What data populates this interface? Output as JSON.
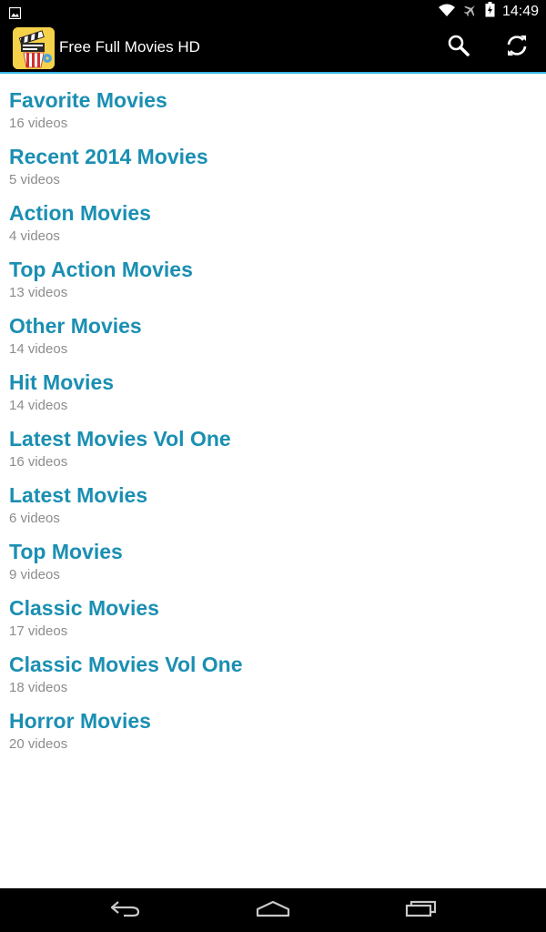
{
  "status_bar": {
    "time": "14:49",
    "icons": [
      "image-notification-icon",
      "wifi-icon",
      "airplane-mode-icon",
      "battery-icon"
    ]
  },
  "action_bar": {
    "app_title": "Free Full Movies HD",
    "actions": [
      "search-icon",
      "refresh-icon"
    ]
  },
  "colors": {
    "accent": "#33b5e5",
    "title_text": "#1b8fb2",
    "subtitle_text": "#8c8c8c",
    "bar_background": "#000000"
  },
  "playlists": [
    {
      "title": "Favorite Movies",
      "count": "16 videos"
    },
    {
      "title": "Recent 2014 Movies",
      "count": "5 videos"
    },
    {
      "title": "Action Movies",
      "count": "4 videos"
    },
    {
      "title": "Top Action Movies",
      "count": "13 videos"
    },
    {
      "title": "Other Movies",
      "count": "14 videos"
    },
    {
      "title": "Hit Movies",
      "count": "14 videos"
    },
    {
      "title": "Latest Movies Vol One",
      "count": "16 videos"
    },
    {
      "title": "Latest Movies",
      "count": "6 videos"
    },
    {
      "title": "Top Movies",
      "count": "9 videos"
    },
    {
      "title": "Classic Movies",
      "count": "17 videos"
    },
    {
      "title": "Classic Movies Vol One",
      "count": "18 videos"
    },
    {
      "title": "Horror Movies",
      "count": "20 videos"
    }
  ],
  "nav_bar": {
    "buttons": [
      "back-icon",
      "home-icon",
      "recents-icon"
    ]
  }
}
